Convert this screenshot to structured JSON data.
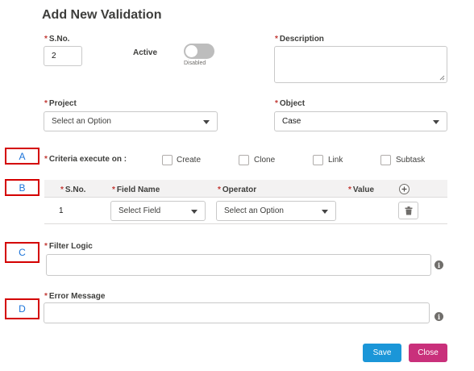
{
  "page": {
    "title": "Add New Validation"
  },
  "form": {
    "required_mark": "*",
    "sno": {
      "label": "S.No.",
      "value": "2"
    },
    "active": {
      "label": "Active",
      "toggle_status": "Disabled"
    },
    "description": {
      "label": "Description",
      "value": ""
    },
    "project": {
      "label": "Project",
      "value": "Select an Option"
    },
    "object": {
      "label": "Object",
      "value": "Case"
    },
    "criteria": {
      "label": "Criteria execute on :",
      "options": [
        {
          "label": "Create",
          "checked": false
        },
        {
          "label": "Clone",
          "checked": false
        },
        {
          "label": "Link",
          "checked": false
        },
        {
          "label": "Subtask",
          "checked": false
        }
      ]
    },
    "criteria_table": {
      "headers": {
        "sno": "S.No.",
        "field_name": "Field Name",
        "operator": "Operator",
        "value": "Value"
      },
      "add_icon": "plus-circle-icon",
      "rows": [
        {
          "sno": "1",
          "field": "Select Field",
          "operator": "Select an Option",
          "delete_icon": "trash-icon"
        }
      ]
    },
    "filter_logic": {
      "label": "Filter Logic",
      "value": ""
    },
    "error_message": {
      "label": "Error Message",
      "value": ""
    }
  },
  "markers": {
    "a": "A",
    "b": "B",
    "c": "C",
    "d": "D"
  },
  "info_glyph": "i",
  "buttons": {
    "save": "Save",
    "close": "Close"
  },
  "colors": {
    "save": "#1b96d8",
    "close": "#c9307b",
    "marker_border": "#d40000",
    "marker_text": "#1a73d9",
    "required": "#c23934"
  }
}
